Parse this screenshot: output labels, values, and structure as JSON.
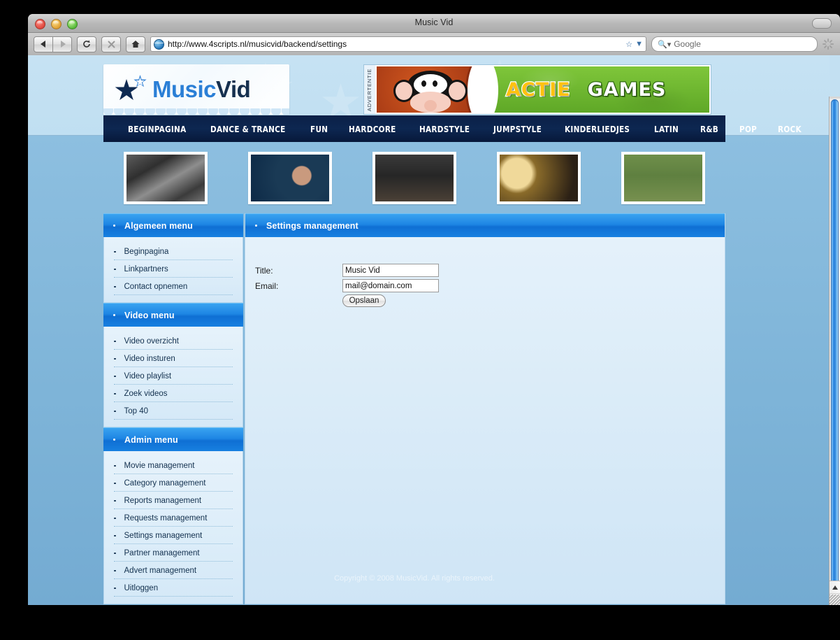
{
  "browser": {
    "window_title": "Music Vid",
    "url": "http://www.4scripts.nl/musicvid/backend/settings",
    "search_placeholder": "Google",
    "search_value": "Google",
    "nav_back_icon": "back-arrow-icon",
    "nav_forward_icon": "forward-arrow-icon",
    "reload_icon": "reload-icon",
    "stop_icon": "stop-icon",
    "home_icon": "home-icon",
    "bookmark_icon": "star-icon",
    "dropdown_icon": "chevron-down-icon",
    "globe_icon": "globe-icon",
    "magnifier_icon": "search-icon",
    "spinner_icon": "spinner-icon",
    "toolbar_toggle_icon": "toolbar-toggle-icon",
    "traffic": {
      "close": "close-window-button",
      "minimize": "minimize-window-button",
      "zoom": "zoom-window-button"
    }
  },
  "site": {
    "logo": {
      "part_a": "Music",
      "part_b": "Vid",
      "star_icon": "star-logo-icon"
    },
    "ad": {
      "label": "ADVERTENTIE",
      "word1": "ACTIE",
      "word2": "GAMES",
      "mascot_icon": "monkey-mascot-icon"
    },
    "nav": [
      {
        "label": "BEGINPAGINA"
      },
      {
        "label": "DANCE & TRANCE"
      },
      {
        "label": "FUN"
      },
      {
        "label": "HARDCORE"
      },
      {
        "label": "HARDSTYLE"
      },
      {
        "label": "JUMPSTYLE"
      },
      {
        "label": "KINDERLIEDJES"
      },
      {
        "label": "LATIN"
      },
      {
        "label": "R&B"
      },
      {
        "label": "POP"
      },
      {
        "label": "ROCK"
      }
    ],
    "thumbnails": [
      {
        "name": "video-thumbnail-1"
      },
      {
        "name": "video-thumbnail-2"
      },
      {
        "name": "video-thumbnail-3"
      },
      {
        "name": "video-thumbnail-4"
      },
      {
        "name": "video-thumbnail-5"
      }
    ],
    "sidebar": {
      "panels": [
        {
          "title": "Algemeen menu",
          "items": [
            "Beginpagina",
            "Linkpartners",
            "Contact opnemen"
          ]
        },
        {
          "title": "Video menu",
          "items": [
            "Video overzicht",
            "Video insturen",
            "Video playlist",
            "Zoek videos",
            "Top 40"
          ]
        },
        {
          "title": "Admin menu",
          "items": [
            "Movie management",
            "Category management",
            "Reports management",
            "Requests management",
            "Settings management",
            "Partner management",
            "Advert management",
            "Uitloggen"
          ]
        }
      ]
    },
    "content": {
      "panel_title": "Settings management",
      "form": {
        "title_label": "Title:",
        "title_value": "Music Vid",
        "email_label": "Email:",
        "email_value": "mail@domain.com",
        "submit_label": "Opslaan"
      }
    },
    "footer": {
      "copyright": "Copyright © 2008 MusicVid. All rights reserved."
    }
  },
  "colors": {
    "nav_bg": "#0b2047",
    "panel_header": "#1e86e4",
    "logo_blue": "#2b7fd6",
    "logo_navy": "#16304f",
    "page_top": "#c6e2f3",
    "page_bottom": "#7eb4d8",
    "ad_green": "#6fbb2d",
    "ad_orange": "#b8411a",
    "ad_yellow": "#ffc20e"
  }
}
